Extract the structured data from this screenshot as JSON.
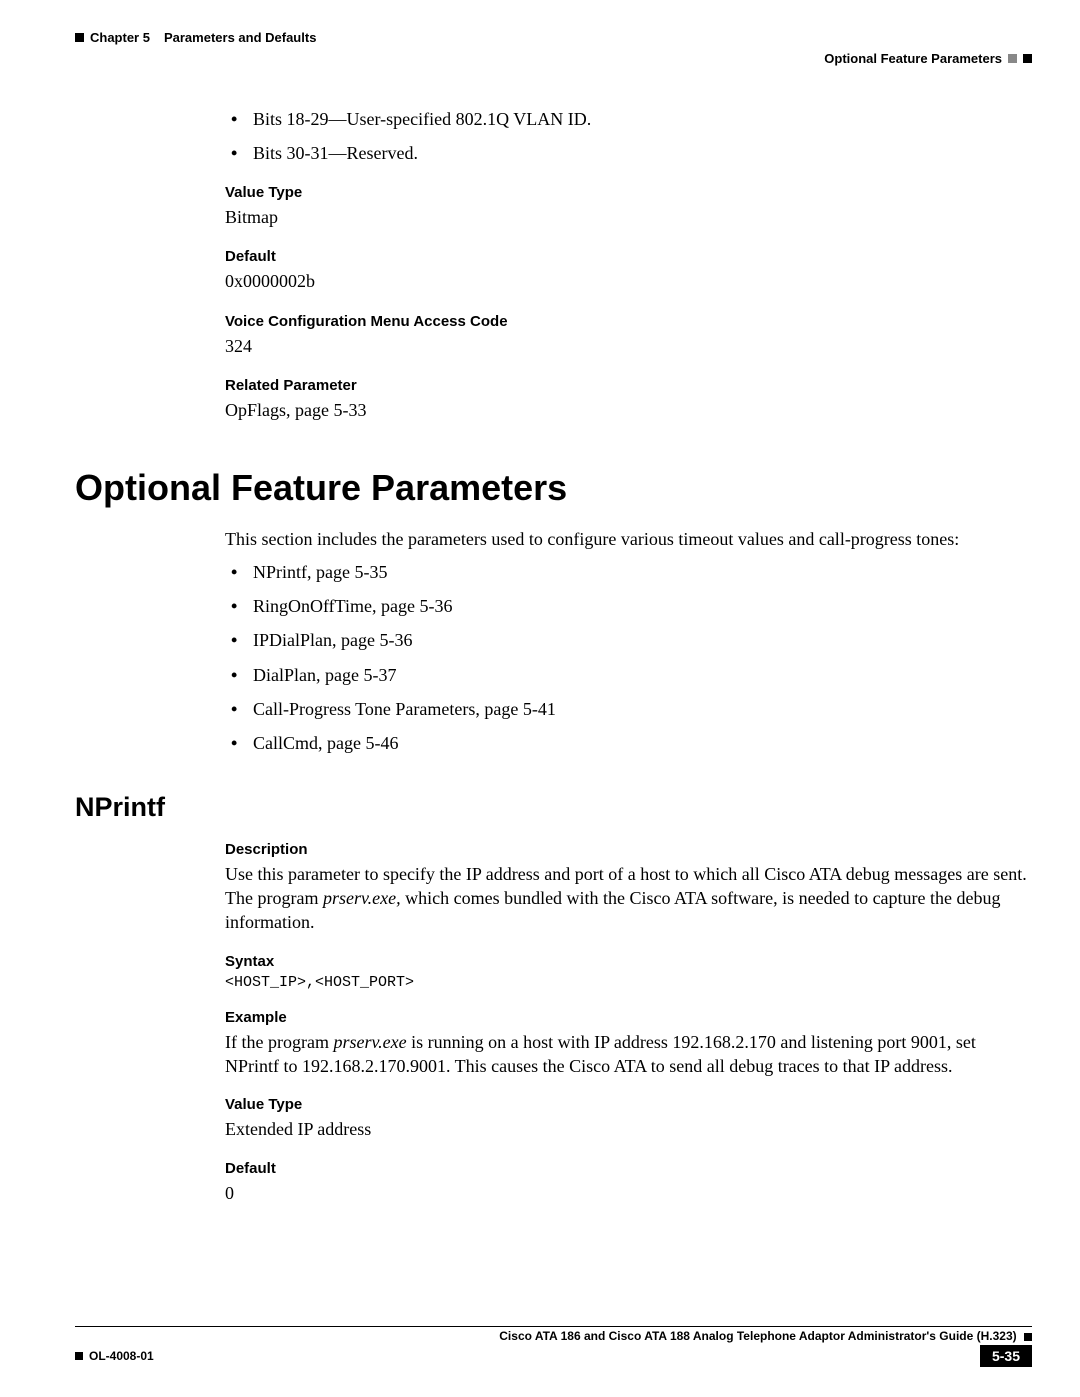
{
  "header": {
    "chapter": "Chapter 5",
    "title": "Parameters and Defaults",
    "subtitle": "Optional Feature Parameters"
  },
  "top_bullets": [
    "Bits 18-29—User-specified 802.1Q VLAN ID.",
    "Bits 30-31—Reserved."
  ],
  "fields1": {
    "value_type_label": "Value Type",
    "value_type": "Bitmap",
    "default_label": "Default",
    "default": "0x0000002b",
    "voice_label": "Voice Configuration Menu Access Code",
    "voice": "324",
    "related_label": "Related Parameter",
    "related": "OpFlags, page 5-33"
  },
  "section_heading": "Optional Feature Parameters",
  "section_intro": "This section includes the parameters used to configure various timeout values and call-progress tones:",
  "section_bullets": [
    "NPrintf, page 5-35",
    "RingOnOffTime, page 5-36",
    "IPDialPlan, page 5-36",
    "DialPlan, page 5-37",
    "Call-Progress Tone Parameters, page 5-41",
    "CallCmd, page 5-46"
  ],
  "subsection_heading": "NPrintf",
  "nprintf": {
    "description_label": "Description",
    "description_pre": "Use this parameter to specify the IP address and port of a host to which all Cisco ATA debug messages are sent. The program ",
    "description_italic": "prserv.exe,",
    "description_post": " which comes bundled with the Cisco ATA software, is needed to capture the debug information.",
    "syntax_label": "Syntax",
    "syntax": "<HOST_IP>,<HOST_PORT>",
    "example_label": "Example",
    "example_pre": "If the program ",
    "example_italic": "prserv.exe",
    "example_post": " is running on a host with IP address 192.168.2.170 and listening port 9001, set NPrintf to 192.168.2.170.9001. This causes the Cisco ATA to send all debug traces to that IP address.",
    "value_type_label": "Value Type",
    "value_type": "Extended IP address",
    "default_label": "Default",
    "default": "0"
  },
  "footer": {
    "guide": "Cisco ATA 186 and Cisco ATA 188 Analog Telephone Adaptor Administrator's Guide (H.323)",
    "docnum": "OL-4008-01",
    "pagenum": "5-35"
  }
}
